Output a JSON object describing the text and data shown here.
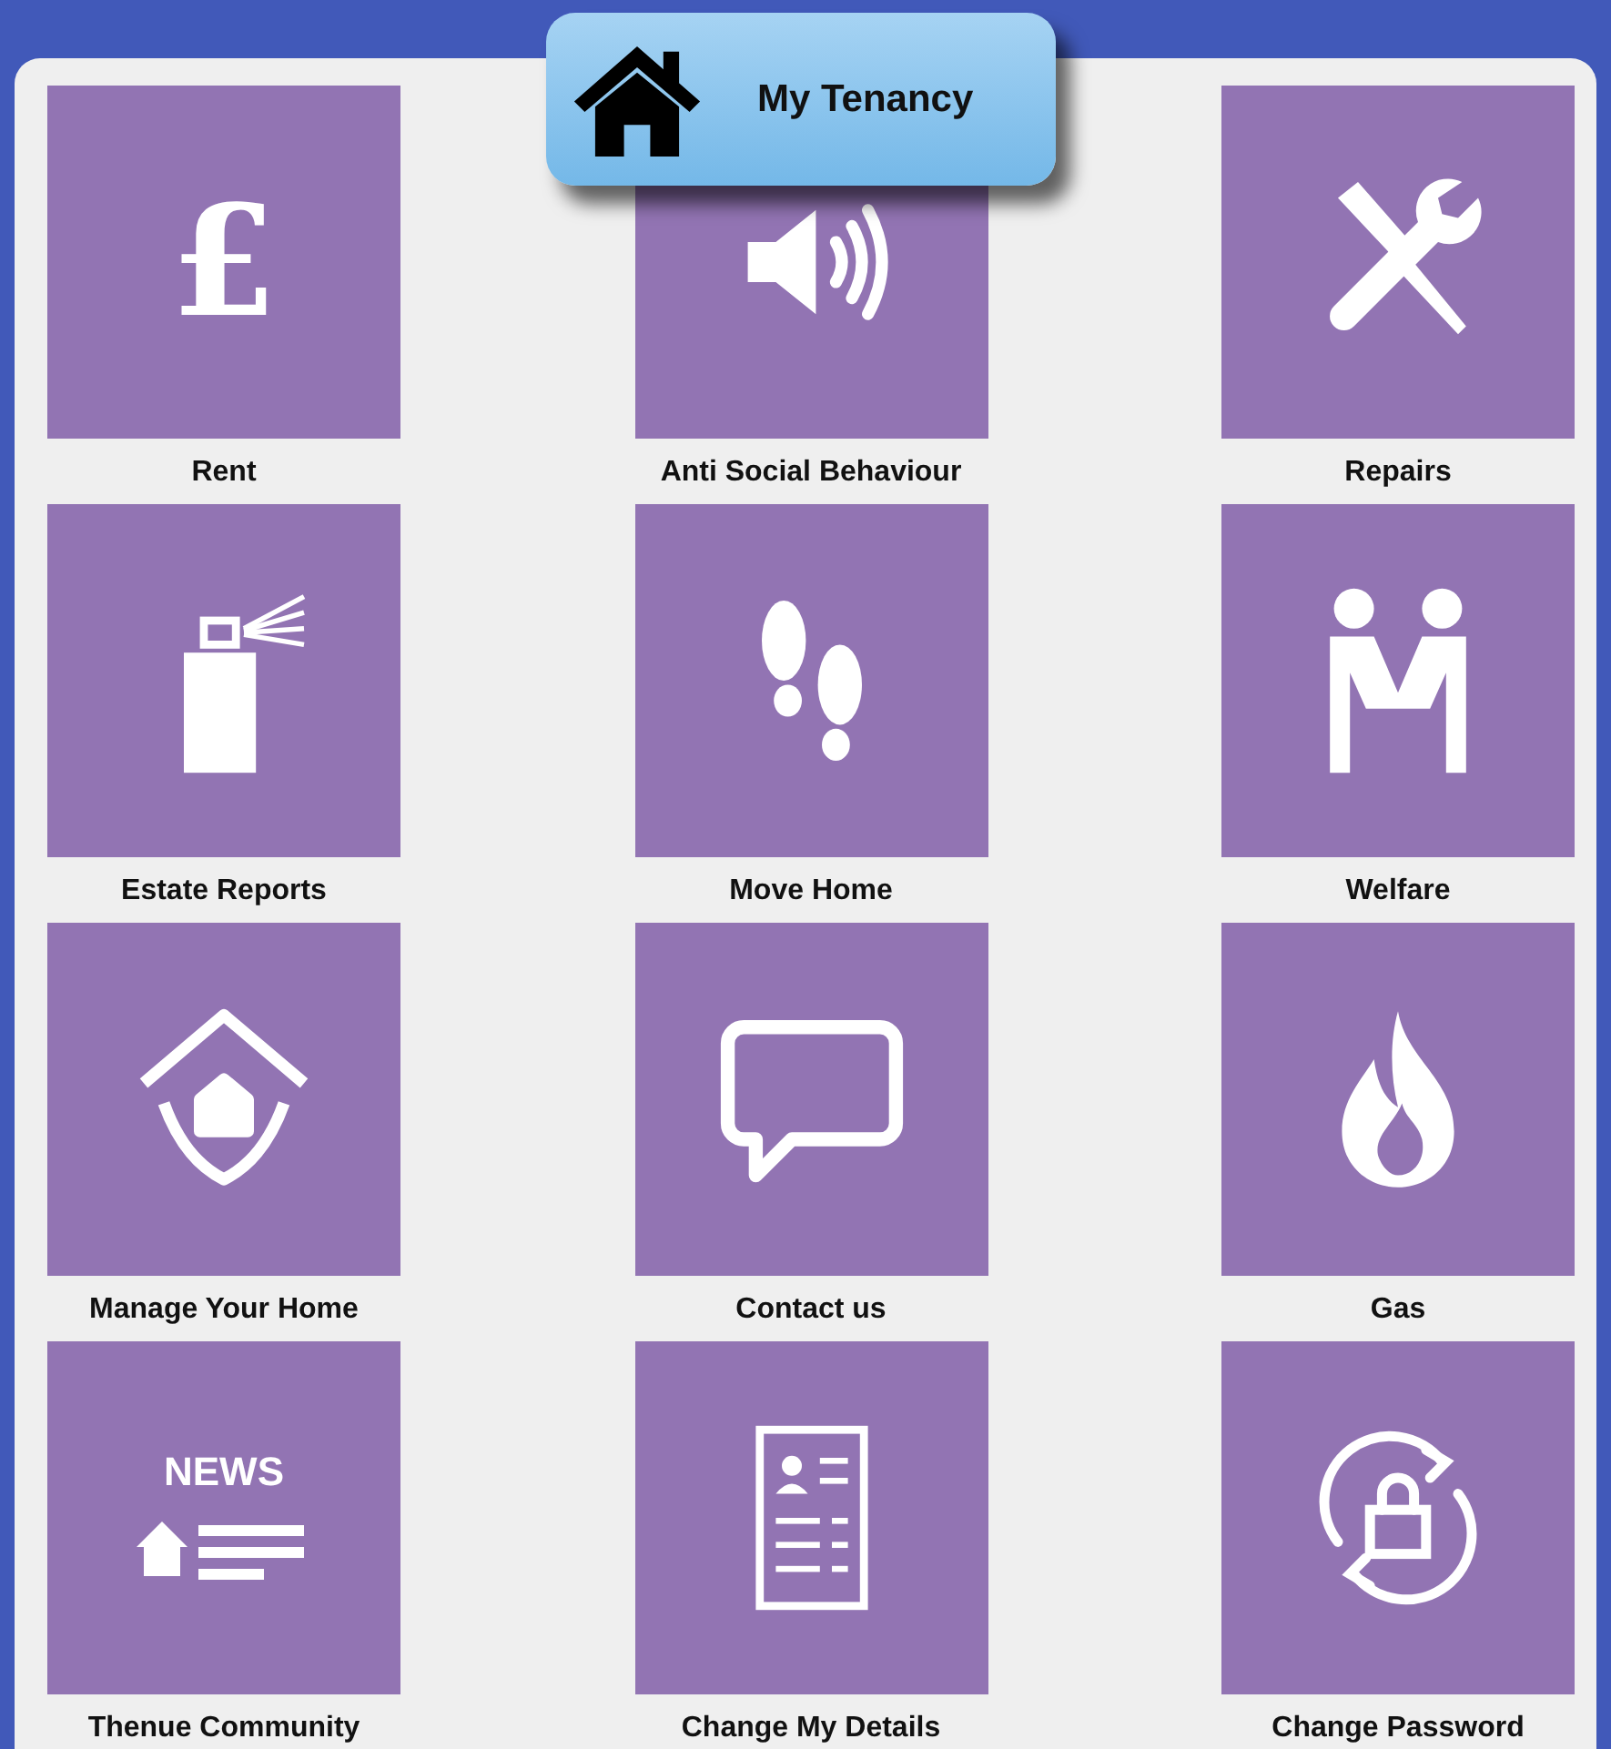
{
  "header": {
    "title": "My Tenancy"
  },
  "tiles": [
    {
      "label": "Rent",
      "kind": "pound",
      "icon_text": "£"
    },
    {
      "label": "Anti Social Behaviour",
      "kind": "speaker"
    },
    {
      "label": "Repairs",
      "kind": "tools"
    },
    {
      "label": "Estate Reports",
      "kind": "spray"
    },
    {
      "label": "Move Home",
      "kind": "footprints"
    },
    {
      "label": "Welfare",
      "kind": "handshake"
    },
    {
      "label": "Manage Your Home",
      "kind": "homecare"
    },
    {
      "label": "Contact us",
      "kind": "speech"
    },
    {
      "label": "Gas",
      "kind": "flame"
    },
    {
      "label": "Thenue Community",
      "kind": "news",
      "icon_text": "NEWS"
    },
    {
      "label": "Change My Details",
      "kind": "document"
    },
    {
      "label": "Change Password",
      "kind": "lock"
    }
  ]
}
